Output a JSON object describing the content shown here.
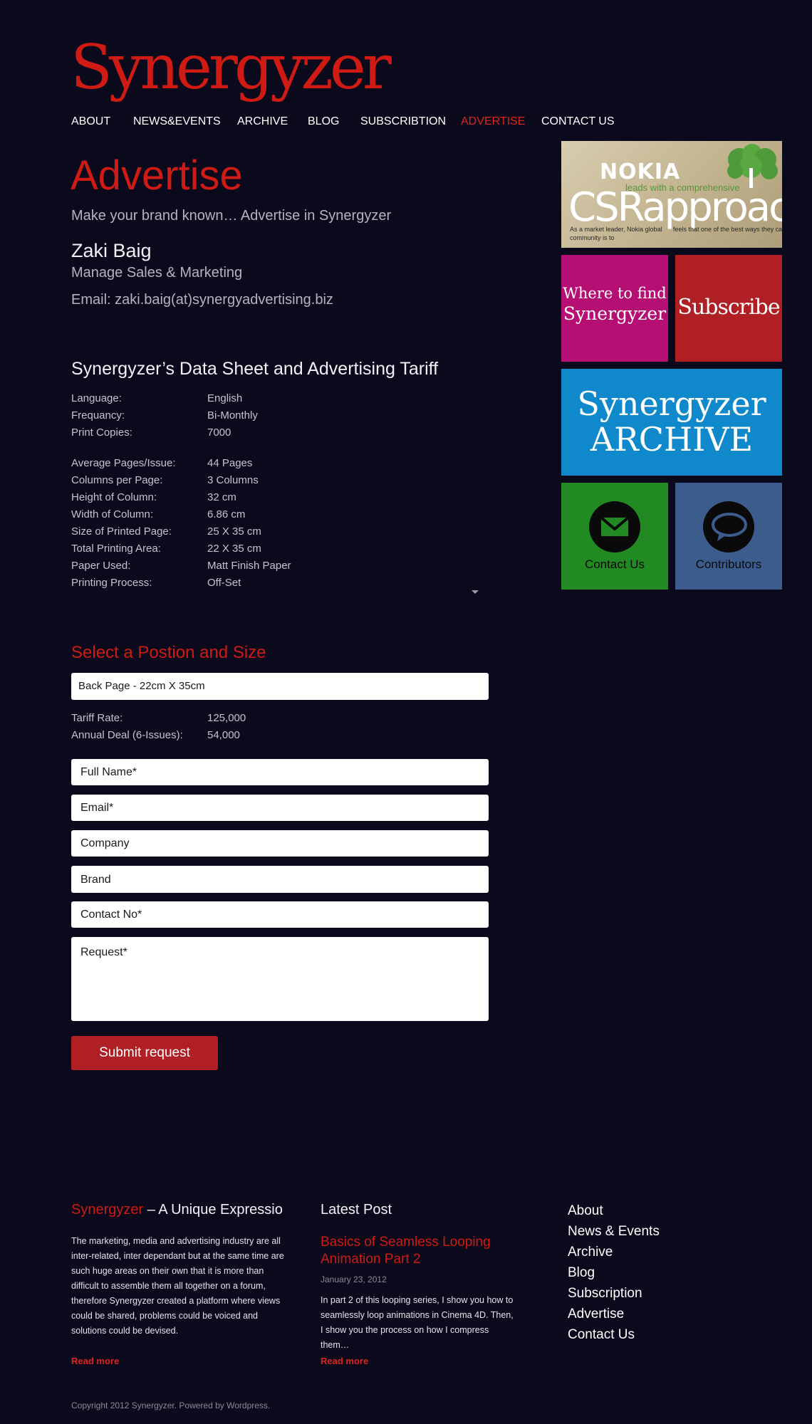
{
  "site": {
    "logo_text": "Synergyzer"
  },
  "nav": {
    "items": [
      {
        "label": "ABOUT"
      },
      {
        "label": "NEWS&EVENTS"
      },
      {
        "label": "ARCHIVE"
      },
      {
        "label": "BLOG"
      },
      {
        "label": "SUBSCRIBTION"
      },
      {
        "label": "ADVERTISE"
      },
      {
        "label": "CONTACT US"
      }
    ],
    "active": "ADVERTISE"
  },
  "main": {
    "title": "Advertise",
    "lead": "Make your brand known… Advertise in Synergyzer",
    "contact": {
      "name": "Zaki Baig",
      "role": "Manage Sales & Marketing",
      "email": "Email: zaki.baig(at)synergyadvertising.biz"
    },
    "data_sheet": {
      "title": "Synergyzer’s Data Sheet and  Advertising Tariff",
      "group1": [
        {
          "label": "Language:",
          "value": "English"
        },
        {
          "label": "Frequancy:",
          "value": "Bi-Monthly"
        },
        {
          "label": "Print Copies:",
          "value": "7000"
        }
      ],
      "group2": [
        {
          "label": "Average Pages/Issue:",
          "value": "44 Pages"
        },
        {
          "label": "Columns per Page:",
          "value": "3 Columns"
        },
        {
          "label": "Height of Column:",
          "value": "32 cm"
        },
        {
          "label": "Width of Column:",
          "value": "6.86 cm"
        },
        {
          "label": "Size of Printed Page:",
          "value": "25 X 35 cm"
        },
        {
          "label": "Total Printing Area:",
          "value": "22 X 35 cm"
        },
        {
          "label": "Paper Used:",
          "value": "Matt Finish Paper"
        },
        {
          "label": "Printing Process:",
          "value": "Off-Set"
        }
      ]
    },
    "position": {
      "title": "Select a Postion and Size",
      "selected": "Back Page - 22cm X 35cm",
      "tariff": [
        {
          "label": "Tariff Rate:",
          "value": "125,000"
        },
        {
          "label": "Annual Deal (6-Issues):",
          "value": "54,000"
        }
      ]
    },
    "form": {
      "full_name_placeholder": "Full Name*",
      "email_placeholder": "Email*",
      "company_placeholder": "Company",
      "brand_placeholder": "Brand",
      "contact_placeholder": "Contact No*",
      "request_placeholder": "Request*",
      "submit_label": "Submit request"
    }
  },
  "sidebar": {
    "nokia": {
      "brand": "NOKIA",
      "tagline": "leads with a comprehensive",
      "headline": "CSRapproach",
      "body_left": "As a market leader, Nokia global community is to",
      "body_right": "feels that one of the best ways they ca conductbusiness in a responsible way"
    },
    "find": {
      "line1": "Where to find",
      "line2": "Synergyzer"
    },
    "subscribe": {
      "label": "Subscribe"
    },
    "archive": {
      "line1": "Synergyzer",
      "line2": "ARCHIVE"
    },
    "contact": {
      "label": "Contact Us",
      "icon": "envelope-icon"
    },
    "contributors": {
      "label": "Contributors",
      "icon": "speech-bubble-icon"
    },
    "colors": {
      "find": "#b50f74",
      "subscribe": "#b01f23",
      "archive": "#1088cc",
      "contact": "#228a22",
      "contributors": "#3d5c8e"
    }
  },
  "footer": {
    "about": {
      "brand": "Synergyzer",
      "heading_rest": " – A Unique Expressio",
      "text": "The marketing, media and advertising industry are all inter-related, inter dependant but at the same time are such huge areas on their own that it is more than difficult to assemble them all together on a forum, therefore Synergyzer created a platform where views could be shared, problems could be voiced and solutions could be devised.",
      "read_more": "Read more"
    },
    "latest": {
      "heading": "Latest Post",
      "post_title": "Basics of Seamless Looping Animation Part 2",
      "date": "January 23, 2012",
      "excerpt": "In part 2 of this looping series, I show you how to seamlessly loop animations in Cinema 4D. Then, I show you the process on how I compress them…",
      "read_more": "Read more"
    },
    "links": [
      {
        "label": "About"
      },
      {
        "label": "News & Events"
      },
      {
        "label": "Archive"
      },
      {
        "label": "Blog"
      },
      {
        "label": "Subscription"
      },
      {
        "label": "Advertise"
      },
      {
        "label": "Contact Us"
      }
    ],
    "copyright": "Copyright 2012 Synergyzer. Powered by Wordpress."
  },
  "colors": {
    "background": "#0a0a1c",
    "accent": "#d01a14",
    "button": "#b01f23"
  }
}
